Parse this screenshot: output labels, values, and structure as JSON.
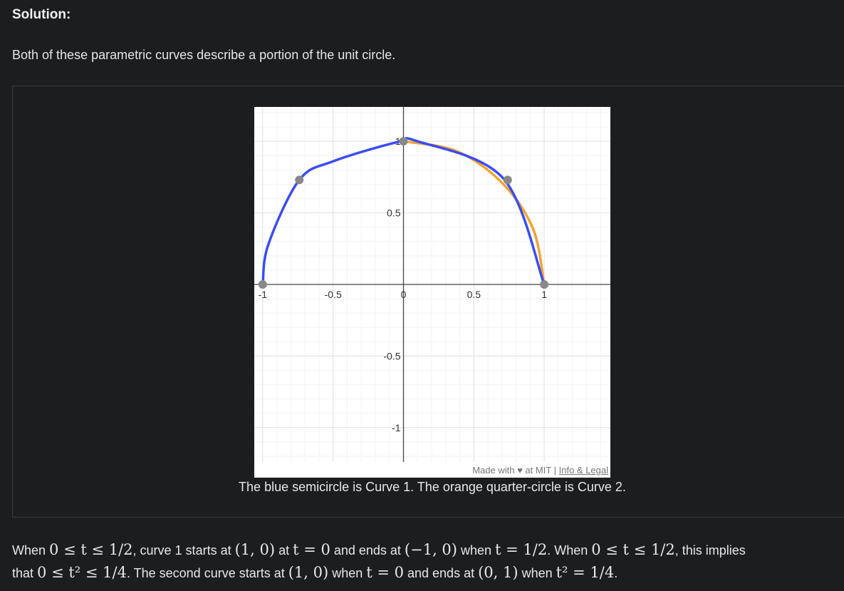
{
  "heading": "Solution:",
  "intro": "Both of these parametric curves describe a portion of the unit circle.",
  "figure": {
    "footer_made": "Made with ♥ at MIT | ",
    "footer_link": "Info & Legal",
    "caption": "The blue semicircle is Curve 1. The orange quarter-circle is Curve 2."
  },
  "chart_data": {
    "type": "line",
    "x_ticks": [
      "-1",
      "-0.5",
      "0",
      "0.5",
      "1"
    ],
    "y_ticks": [
      "1",
      "0.5",
      "-0.5",
      "-1"
    ],
    "xlim": [
      -1.06,
      1.47
    ],
    "ylim": [
      -1.24,
      1.24
    ],
    "grid": true,
    "series": [
      {
        "name": "Curve 1",
        "color": "#3b4cf5",
        "points": [
          [
            1,
            0
          ],
          [
            0.71,
            0.74
          ],
          [
            0.1,
            1.0
          ],
          [
            -0.06,
            0.99
          ],
          [
            -0.5,
            0.86
          ],
          [
            -0.74,
            0.73
          ],
          [
            -0.96,
            0.28
          ],
          [
            -1,
            0
          ]
        ]
      },
      {
        "name": "Curve 2",
        "color": "#f2a530",
        "points": [
          [
            1,
            0
          ],
          [
            0.92,
            0.39
          ],
          [
            0.7,
            0.71
          ],
          [
            0.38,
            0.93
          ],
          [
            0,
            1
          ]
        ]
      }
    ],
    "markers": [
      [
        -1,
        0
      ],
      [
        -0.74,
        0.73
      ],
      [
        0,
        1
      ],
      [
        0.74,
        0.73
      ],
      [
        1,
        0
      ]
    ],
    "marker_color": "#888888"
  },
  "paragraph": {
    "line1": [
      {
        "t": "text",
        "v": "When "
      },
      {
        "t": "math",
        "v": "0 ≤ t ≤ 1/2"
      },
      {
        "t": "text",
        "v": ", curve 1 starts at "
      },
      {
        "t": "math",
        "v": "(1, 0)"
      },
      {
        "t": "text",
        "v": " at "
      },
      {
        "t": "math",
        "v": "t = 0"
      },
      {
        "t": "text",
        "v": " and ends at "
      },
      {
        "t": "math",
        "v": "(−1, 0)"
      },
      {
        "t": "text",
        "v": " when "
      },
      {
        "t": "math",
        "v": "t = 1/2"
      },
      {
        "t": "text",
        "v": ". When "
      },
      {
        "t": "math",
        "v": "0 ≤ t ≤ 1/2"
      },
      {
        "t": "text",
        "v": ", this implies"
      }
    ],
    "line2": [
      {
        "t": "text",
        "v": "that "
      },
      {
        "t": "math",
        "v": "0 ≤ t² ≤ 1/4"
      },
      {
        "t": "text",
        "v": ". The second curve starts at "
      },
      {
        "t": "math",
        "v": "(1, 0)"
      },
      {
        "t": "text",
        "v": " when "
      },
      {
        "t": "math",
        "v": "t = 0"
      },
      {
        "t": "text",
        "v": " and ends at "
      },
      {
        "t": "math",
        "v": "(0, 1)"
      },
      {
        "t": "text",
        "v": " when "
      },
      {
        "t": "math",
        "v": "t² = 1/4"
      },
      {
        "t": "text",
        "v": "."
      }
    ]
  }
}
